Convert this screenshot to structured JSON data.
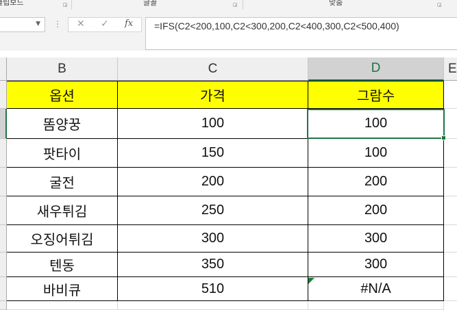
{
  "ribbon": {
    "groups": [
      "클립보드",
      "글꼴",
      "맞춤"
    ]
  },
  "formula_bar": {
    "name_box": "",
    "cancel_icon": "✕",
    "enter_icon": "✓",
    "fx_label": "fx",
    "formula": "=IFS(C2<200,100,C2<300,200,C2<400,300,C2<500,400)"
  },
  "columns": [
    "B",
    "C",
    "D",
    "E"
  ],
  "selected_column": "D",
  "table": {
    "headers": [
      "옵션",
      "가격",
      "그람수"
    ],
    "rows": [
      [
        "똠양꿍",
        "100",
        "100"
      ],
      [
        "팟타이",
        "150",
        "100"
      ],
      [
        "굴전",
        "200",
        "200"
      ],
      [
        "새우튀김",
        "250",
        "200"
      ],
      [
        "오징어튀김",
        "300",
        "300"
      ],
      [
        "텐동",
        "350",
        "300"
      ],
      [
        "바비큐",
        "510",
        "#N/A"
      ]
    ]
  },
  "colors": {
    "header_fill": "#ffff00",
    "selection": "#217346"
  }
}
